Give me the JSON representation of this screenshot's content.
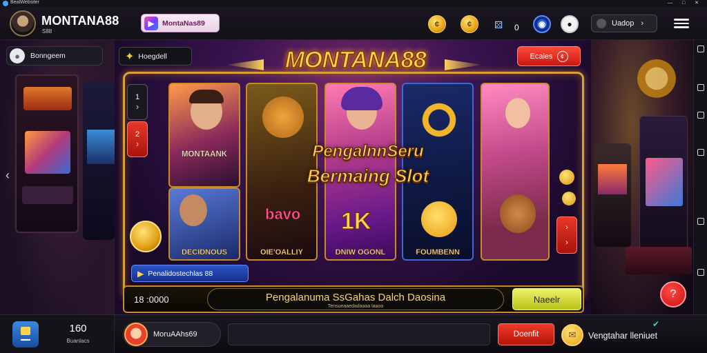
{
  "window": {
    "app_name": "BeatWebsiter"
  },
  "header": {
    "brand": "MONTANA88",
    "brand_sub": "S88",
    "promo_chip_label": "MontaNas89",
    "counter_value": "0",
    "language_button": "Uadop",
    "language_arrow": "›"
  },
  "sidebar_left": {
    "user_name": "Bonngeem"
  },
  "banner": {
    "tag_label": "Hoegdell",
    "title": "MONTANA88",
    "top_right_button": "Ecales",
    "step_1": "1",
    "step_2": "2",
    "card_1_caption": "MONTAANK",
    "card_1b_caption": "DECIDNOUS",
    "card_2_caption": "OIE'OALLIY",
    "card_2_title": "bavo",
    "card_3_caption": "DNIW OGONL",
    "card_3_title": "1K",
    "card_4_caption": "FOUMBENN",
    "overlay_line_1": "PengalnnSeru",
    "overlay_line_2": "Bermaing Slot",
    "promo_bar_label": "Penalidostechlas 88",
    "bottom_code": "18 :0000",
    "bottom_text": "Pengalanuma SsGahas Dalch Daosina",
    "bottom_subtext": "Tensueaaedadaaaa laaoo",
    "go_button": "Naeelr"
  },
  "dock": {
    "count_value": "160",
    "count_label": "Buanlacs",
    "player_name": "MoruAAhs69",
    "deposit_button": "Doenfit",
    "bottom_label": "Vengtahar lleniuet"
  }
}
